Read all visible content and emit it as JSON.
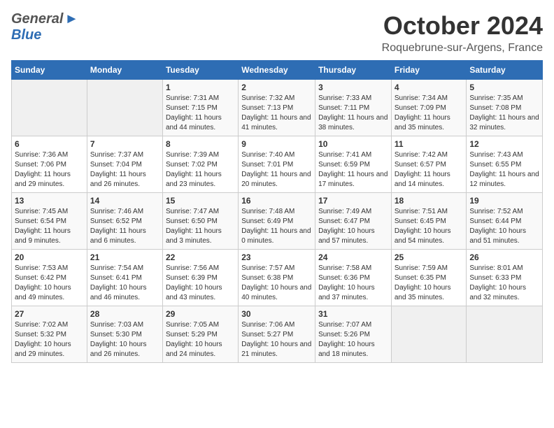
{
  "header": {
    "logo_general": "General",
    "logo_blue": "Blue",
    "month_title": "October 2024",
    "location": "Roquebrune-sur-Argens, France"
  },
  "columns": [
    "Sunday",
    "Monday",
    "Tuesday",
    "Wednesday",
    "Thursday",
    "Friday",
    "Saturday"
  ],
  "weeks": [
    {
      "days": [
        {
          "num": "",
          "sunrise": "",
          "sunset": "",
          "daylight": "",
          "empty": true
        },
        {
          "num": "",
          "sunrise": "",
          "sunset": "",
          "daylight": "",
          "empty": true
        },
        {
          "num": "1",
          "sunrise": "Sunrise: 7:31 AM",
          "sunset": "Sunset: 7:15 PM",
          "daylight": "Daylight: 11 hours and 44 minutes.",
          "empty": false
        },
        {
          "num": "2",
          "sunrise": "Sunrise: 7:32 AM",
          "sunset": "Sunset: 7:13 PM",
          "daylight": "Daylight: 11 hours and 41 minutes.",
          "empty": false
        },
        {
          "num": "3",
          "sunrise": "Sunrise: 7:33 AM",
          "sunset": "Sunset: 7:11 PM",
          "daylight": "Daylight: 11 hours and 38 minutes.",
          "empty": false
        },
        {
          "num": "4",
          "sunrise": "Sunrise: 7:34 AM",
          "sunset": "Sunset: 7:09 PM",
          "daylight": "Daylight: 11 hours and 35 minutes.",
          "empty": false
        },
        {
          "num": "5",
          "sunrise": "Sunrise: 7:35 AM",
          "sunset": "Sunset: 7:08 PM",
          "daylight": "Daylight: 11 hours and 32 minutes.",
          "empty": false
        }
      ]
    },
    {
      "days": [
        {
          "num": "6",
          "sunrise": "Sunrise: 7:36 AM",
          "sunset": "Sunset: 7:06 PM",
          "daylight": "Daylight: 11 hours and 29 minutes.",
          "empty": false
        },
        {
          "num": "7",
          "sunrise": "Sunrise: 7:37 AM",
          "sunset": "Sunset: 7:04 PM",
          "daylight": "Daylight: 11 hours and 26 minutes.",
          "empty": false
        },
        {
          "num": "8",
          "sunrise": "Sunrise: 7:39 AM",
          "sunset": "Sunset: 7:02 PM",
          "daylight": "Daylight: 11 hours and 23 minutes.",
          "empty": false
        },
        {
          "num": "9",
          "sunrise": "Sunrise: 7:40 AM",
          "sunset": "Sunset: 7:01 PM",
          "daylight": "Daylight: 11 hours and 20 minutes.",
          "empty": false
        },
        {
          "num": "10",
          "sunrise": "Sunrise: 7:41 AM",
          "sunset": "Sunset: 6:59 PM",
          "daylight": "Daylight: 11 hours and 17 minutes.",
          "empty": false
        },
        {
          "num": "11",
          "sunrise": "Sunrise: 7:42 AM",
          "sunset": "Sunset: 6:57 PM",
          "daylight": "Daylight: 11 hours and 14 minutes.",
          "empty": false
        },
        {
          "num": "12",
          "sunrise": "Sunrise: 7:43 AM",
          "sunset": "Sunset: 6:55 PM",
          "daylight": "Daylight: 11 hours and 12 minutes.",
          "empty": false
        }
      ]
    },
    {
      "days": [
        {
          "num": "13",
          "sunrise": "Sunrise: 7:45 AM",
          "sunset": "Sunset: 6:54 PM",
          "daylight": "Daylight: 11 hours and 9 minutes.",
          "empty": false
        },
        {
          "num": "14",
          "sunrise": "Sunrise: 7:46 AM",
          "sunset": "Sunset: 6:52 PM",
          "daylight": "Daylight: 11 hours and 6 minutes.",
          "empty": false
        },
        {
          "num": "15",
          "sunrise": "Sunrise: 7:47 AM",
          "sunset": "Sunset: 6:50 PM",
          "daylight": "Daylight: 11 hours and 3 minutes.",
          "empty": false
        },
        {
          "num": "16",
          "sunrise": "Sunrise: 7:48 AM",
          "sunset": "Sunset: 6:49 PM",
          "daylight": "Daylight: 11 hours and 0 minutes.",
          "empty": false
        },
        {
          "num": "17",
          "sunrise": "Sunrise: 7:49 AM",
          "sunset": "Sunset: 6:47 PM",
          "daylight": "Daylight: 10 hours and 57 minutes.",
          "empty": false
        },
        {
          "num": "18",
          "sunrise": "Sunrise: 7:51 AM",
          "sunset": "Sunset: 6:45 PM",
          "daylight": "Daylight: 10 hours and 54 minutes.",
          "empty": false
        },
        {
          "num": "19",
          "sunrise": "Sunrise: 7:52 AM",
          "sunset": "Sunset: 6:44 PM",
          "daylight": "Daylight: 10 hours and 51 minutes.",
          "empty": false
        }
      ]
    },
    {
      "days": [
        {
          "num": "20",
          "sunrise": "Sunrise: 7:53 AM",
          "sunset": "Sunset: 6:42 PM",
          "daylight": "Daylight: 10 hours and 49 minutes.",
          "empty": false
        },
        {
          "num": "21",
          "sunrise": "Sunrise: 7:54 AM",
          "sunset": "Sunset: 6:41 PM",
          "daylight": "Daylight: 10 hours and 46 minutes.",
          "empty": false
        },
        {
          "num": "22",
          "sunrise": "Sunrise: 7:56 AM",
          "sunset": "Sunset: 6:39 PM",
          "daylight": "Daylight: 10 hours and 43 minutes.",
          "empty": false
        },
        {
          "num": "23",
          "sunrise": "Sunrise: 7:57 AM",
          "sunset": "Sunset: 6:38 PM",
          "daylight": "Daylight: 10 hours and 40 minutes.",
          "empty": false
        },
        {
          "num": "24",
          "sunrise": "Sunrise: 7:58 AM",
          "sunset": "Sunset: 6:36 PM",
          "daylight": "Daylight: 10 hours and 37 minutes.",
          "empty": false
        },
        {
          "num": "25",
          "sunrise": "Sunrise: 7:59 AM",
          "sunset": "Sunset: 6:35 PM",
          "daylight": "Daylight: 10 hours and 35 minutes.",
          "empty": false
        },
        {
          "num": "26",
          "sunrise": "Sunrise: 8:01 AM",
          "sunset": "Sunset: 6:33 PM",
          "daylight": "Daylight: 10 hours and 32 minutes.",
          "empty": false
        }
      ]
    },
    {
      "days": [
        {
          "num": "27",
          "sunrise": "Sunrise: 7:02 AM",
          "sunset": "Sunset: 5:32 PM",
          "daylight": "Daylight: 10 hours and 29 minutes.",
          "empty": false
        },
        {
          "num": "28",
          "sunrise": "Sunrise: 7:03 AM",
          "sunset": "Sunset: 5:30 PM",
          "daylight": "Daylight: 10 hours and 26 minutes.",
          "empty": false
        },
        {
          "num": "29",
          "sunrise": "Sunrise: 7:05 AM",
          "sunset": "Sunset: 5:29 PM",
          "daylight": "Daylight: 10 hours and 24 minutes.",
          "empty": false
        },
        {
          "num": "30",
          "sunrise": "Sunrise: 7:06 AM",
          "sunset": "Sunset: 5:27 PM",
          "daylight": "Daylight: 10 hours and 21 minutes.",
          "empty": false
        },
        {
          "num": "31",
          "sunrise": "Sunrise: 7:07 AM",
          "sunset": "Sunset: 5:26 PM",
          "daylight": "Daylight: 10 hours and 18 minutes.",
          "empty": false
        },
        {
          "num": "",
          "sunrise": "",
          "sunset": "",
          "daylight": "",
          "empty": true
        },
        {
          "num": "",
          "sunrise": "",
          "sunset": "",
          "daylight": "",
          "empty": true
        }
      ]
    }
  ]
}
